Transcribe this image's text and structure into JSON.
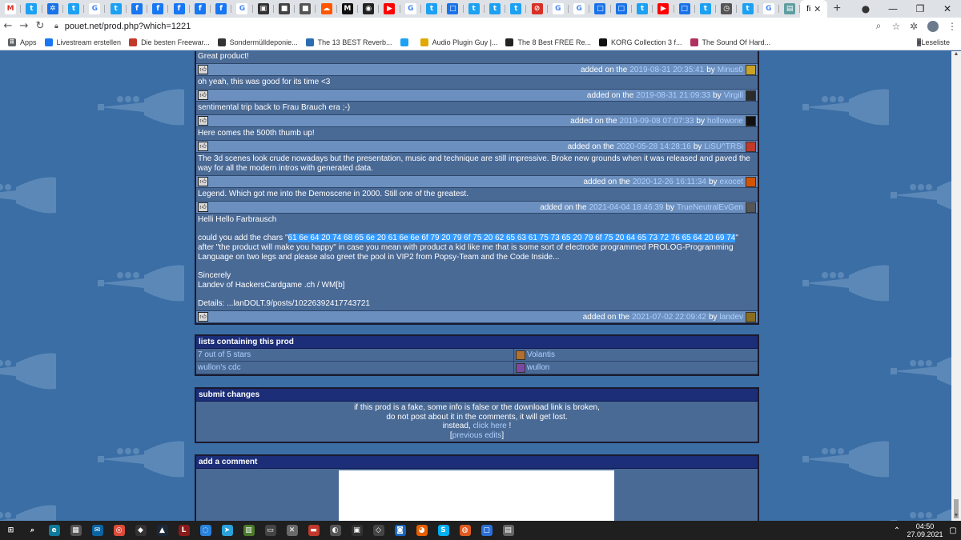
{
  "browser": {
    "active_tab_label": "fi",
    "tabs": [
      {
        "icon": "gmail-icon",
        "glyph": "M",
        "color": "#ffffff",
        "text_color": "#d93025"
      },
      {
        "icon": "twitter-icon",
        "glyph": "t",
        "color": "#1da1f2"
      },
      {
        "icon": "puzzle-icon",
        "glyph": "✲",
        "color": "#1a73e8"
      },
      {
        "icon": "twitter-icon",
        "glyph": "t",
        "color": "#1da1f2"
      },
      {
        "icon": "google-icon",
        "glyph": "G",
        "color": "#ffffff",
        "text_color": "#4285f4"
      },
      {
        "icon": "twitter-icon",
        "glyph": "t",
        "color": "#1da1f2"
      },
      {
        "icon": "facebook-icon",
        "glyph": "f",
        "color": "#1877f2"
      },
      {
        "icon": "facebook-icon",
        "glyph": "f",
        "color": "#1877f2"
      },
      {
        "icon": "facebook-icon",
        "glyph": "f",
        "color": "#1877f2"
      },
      {
        "icon": "facebook-icon",
        "glyph": "f",
        "color": "#1877f2"
      },
      {
        "icon": "facebook-icon",
        "glyph": "f",
        "color": "#1877f2"
      },
      {
        "icon": "google-icon",
        "glyph": "G",
        "color": "#ffffff",
        "text_color": "#4285f4"
      },
      {
        "icon": "camera-icon",
        "glyph": "▣",
        "color": "#333333"
      },
      {
        "icon": "app-icon",
        "glyph": "■",
        "color": "#444444"
      },
      {
        "icon": "app-icon",
        "glyph": "■",
        "color": "#555555"
      },
      {
        "icon": "soundcloud-icon",
        "glyph": "☁",
        "color": "#ff5500"
      },
      {
        "icon": "medium-icon",
        "glyph": "M",
        "color": "#111111"
      },
      {
        "icon": "github-icon",
        "glyph": "◉",
        "color": "#222222"
      },
      {
        "icon": "youtube-icon",
        "glyph": "▶",
        "color": "#ff0000"
      },
      {
        "icon": "google-icon",
        "glyph": "G",
        "color": "#ffffff",
        "text_color": "#4285f4"
      },
      {
        "icon": "twitter-icon",
        "glyph": "t",
        "color": "#1da1f2"
      },
      {
        "icon": "chat-icon",
        "glyph": "□",
        "color": "#1a73e8"
      },
      {
        "icon": "twitter-icon",
        "glyph": "t",
        "color": "#1da1f2"
      },
      {
        "icon": "twitter-icon",
        "glyph": "t",
        "color": "#1da1f2"
      },
      {
        "icon": "twitter-icon",
        "glyph": "t",
        "color": "#1da1f2"
      },
      {
        "icon": "stop-icon",
        "glyph": "⊘",
        "color": "#d93025"
      },
      {
        "icon": "google-icon",
        "glyph": "G",
        "color": "#ffffff",
        "text_color": "#4285f4"
      },
      {
        "icon": "google-icon",
        "glyph": "G",
        "color": "#ffffff",
        "text_color": "#4285f4"
      },
      {
        "icon": "chat-icon",
        "glyph": "□",
        "color": "#1a73e8"
      },
      {
        "icon": "chat-icon",
        "glyph": "□",
        "color": "#1a73e8"
      },
      {
        "icon": "twitter-icon",
        "glyph": "t",
        "color": "#1da1f2"
      },
      {
        "icon": "youtube-icon",
        "glyph": "▶",
        "color": "#ff0000"
      },
      {
        "icon": "chat-icon",
        "glyph": "□",
        "color": "#1a73e8"
      },
      {
        "icon": "twitter-icon",
        "glyph": "t",
        "color": "#1da1f2"
      },
      {
        "icon": "clock-icon",
        "glyph": "◷",
        "color": "#555555"
      },
      {
        "icon": "twitter-icon",
        "glyph": "t",
        "color": "#1da1f2"
      },
      {
        "icon": "google-icon",
        "glyph": "G",
        "color": "#ffffff",
        "text_color": "#4285f4"
      },
      {
        "icon": "doc-icon",
        "glyph": "▤",
        "color": "#5f9ea0"
      }
    ],
    "url": "pouet.net/prod.php?which=1221",
    "bookmarks": [
      {
        "label": "Apps",
        "icon": "apps-grid-icon",
        "color": "#5f6368"
      },
      {
        "label": "Livestream erstellen",
        "icon": "facebook-icon",
        "color": "#1877f2"
      },
      {
        "label": "Die besten Freewar...",
        "icon": "star-icon",
        "color": "#c0392b"
      },
      {
        "label": "Sondermülldeponie...",
        "icon": "wordpress-icon",
        "color": "#333333"
      },
      {
        "label": "The 13 BEST Reverb...",
        "icon": "bookmark-icon",
        "color": "#2b6cb0"
      },
      {
        "label": "",
        "icon": "twitter-icon",
        "color": "#1da1f2"
      },
      {
        "label": "Audio Plugin Guy |...",
        "icon": "plugin-icon",
        "color": "#e0a800"
      },
      {
        "label": "The 8 Best FREE Re...",
        "icon": "bookmark-icon",
        "color": "#222222"
      },
      {
        "label": "KORG Collection 3 f...",
        "icon": "korg-icon",
        "color": "#111111"
      },
      {
        "label": "The Sound Of Hard...",
        "icon": "bookmark-icon",
        "color": "#b03060"
      }
    ],
    "reading_list": "Leseliste"
  },
  "comments": [
    {
      "text": "Great product!",
      "added_on": "added on the",
      "timestamp": "2019-08-31 20:35:41",
      "by": "by",
      "user": "Minus0",
      "avatar_color": "#c9a227"
    },
    {
      "text": "oh yeah, this was good for its time <3",
      "added_on": "added on the",
      "timestamp": "2019-08-31 21:09:33",
      "by": "by",
      "user": "Virgill",
      "avatar_color": "#2b2b2b"
    },
    {
      "text": "sentimental trip back to Frau Brauch era ;-)",
      "added_on": "added on the",
      "timestamp": "2019-09-08 07:07:33",
      "by": "by",
      "user": "hollowone",
      "avatar_color": "#111111"
    },
    {
      "text": "Here comes the 500th thumb up!",
      "added_on": "added on the",
      "timestamp": "2020-05-28 14:28:16",
      "by": "by",
      "user": "LiSU^TRSi",
      "avatar_color": "#c0392b"
    },
    {
      "text": "The 3d scenes look crude nowadays but the presentation, music and technique are still impressive. Broke new grounds when it was released and paved the way for all the modern intros with generated data.",
      "added_on": "added on the",
      "timestamp": "2020-12-26 16:11:34",
      "by": "by",
      "user": "exocet",
      "avatar_color": "#d35400"
    },
    {
      "text": "Legend. Which got me into the Demoscene in 2000. Still one of the greatest.",
      "added_on": "added on the",
      "timestamp": "2021-04-04 18:46:39",
      "by": "by",
      "user": "TrueNeutralEvGen",
      "avatar_color": "#555555"
    }
  ],
  "long_comment": {
    "greeting": "Helli Hello Farbrausch",
    "p1_before": "could you add the chars \"",
    "p1_hex": "61 6e 64 20 74 68 65 6e 20 61 6e 6e 6f 79 20 79 6f 75 20 62 65 63 61 75 73 65 20 79 6f 75 20 64 65 73 72 76 65 64 20 69 74",
    "p1_after": "\" after \"the product will make you happy\" in case you mean with product a kid like me that is some sort of electrode programmed PROLOG-Programming Language on two legs and please also greet the pool in VIP2 from Popsy-Team and the Code Inside...",
    "sign1": "Sincerely",
    "sign2": "Landev of HackersCardgame .ch / WM[b]",
    "details": "Details: ...lanDOLT.9/posts/10226392417743721",
    "added_on": "added on the",
    "timestamp": "2021-07-02 22:09:42",
    "by": "by",
    "user": "landev",
    "avatar_color": "#8a6d1f"
  },
  "lists": {
    "title": "lists containing this prod",
    "rows": [
      {
        "name": "7 out of 5 stars",
        "owner": "Volantis",
        "avatar_color": "#b07030"
      },
      {
        "name": "wullon's cdc",
        "owner": "wullon",
        "avatar_color": "#7a4aa0"
      }
    ]
  },
  "submit": {
    "title": "submit changes",
    "line1": "if this prod is a fake, some info is false or the download link is broken,",
    "line2": "do not post about it in the comments, it will get lost.",
    "line3_before": "instead,",
    "line3_link": "click here",
    "line3_after": "!",
    "line4_open": "[",
    "line4_link": "previous edits",
    "line4_close": "]"
  },
  "add_comment": {
    "title": "add a comment"
  },
  "taskbar": {
    "time": "04:50",
    "date": "27.09.2021",
    "apps": [
      {
        "icon": "windows-start-icon",
        "color": "#1f1f1f",
        "glyph": "⊞"
      },
      {
        "icon": "search-icon",
        "color": "#1f1f1f",
        "glyph": "⌕"
      },
      {
        "icon": "edge-icon",
        "color": "#0f7b9c",
        "glyph": "e"
      },
      {
        "icon": "store-icon",
        "color": "#555555",
        "glyph": "▦"
      },
      {
        "icon": "mail-icon",
        "color": "#0a64a4",
        "glyph": "✉"
      },
      {
        "icon": "chrome-icon",
        "color": "#dd4b39",
        "glyph": "◎"
      },
      {
        "icon": "app-icon",
        "color": "#333333",
        "glyph": "◆"
      },
      {
        "icon": "steam-icon",
        "color": "#1b2838",
        "glyph": "▲"
      },
      {
        "icon": "live-icon",
        "color": "#8b1a1a",
        "glyph": "L"
      },
      {
        "icon": "app-icon",
        "color": "#2a82da",
        "glyph": "◌"
      },
      {
        "icon": "telegram-icon",
        "color": "#2aa1da",
        "glyph": "➤"
      },
      {
        "icon": "app-icon",
        "color": "#4a7a2a",
        "glyph": "▥"
      },
      {
        "icon": "app-icon",
        "color": "#444444",
        "glyph": "▭"
      },
      {
        "icon": "app-icon",
        "color": "#6a6a6a",
        "glyph": "✕"
      },
      {
        "icon": "app-icon",
        "color": "#c0392b",
        "glyph": "▬"
      },
      {
        "icon": "app-icon",
        "color": "#555555",
        "glyph": "◐"
      },
      {
        "icon": "app-icon",
        "color": "#333333",
        "glyph": "▣"
      },
      {
        "icon": "app-icon",
        "color": "#444444",
        "glyph": "◇"
      },
      {
        "icon": "app-icon",
        "color": "#1565c0",
        "glyph": "◙"
      },
      {
        "icon": "firefox-icon",
        "color": "#e66000",
        "glyph": "◕"
      },
      {
        "icon": "skype-icon",
        "color": "#00aff0",
        "glyph": "S"
      },
      {
        "icon": "app-icon",
        "color": "#e05a1f",
        "glyph": "◍"
      },
      {
        "icon": "app-icon",
        "color": "#2a6fd6",
        "glyph": "▢"
      },
      {
        "icon": "app-icon",
        "color": "#666666",
        "glyph": "▤"
      }
    ]
  }
}
